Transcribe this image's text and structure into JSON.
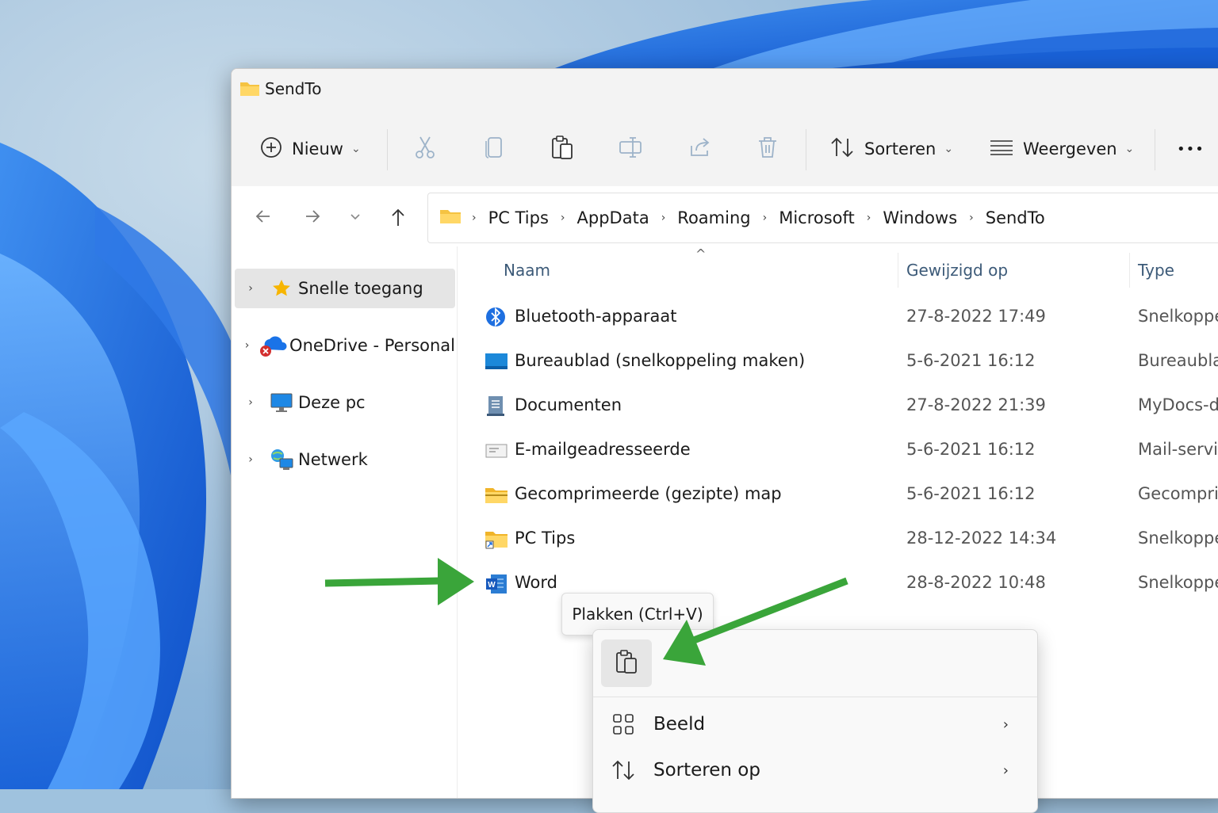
{
  "window": {
    "title": "SendTo"
  },
  "toolbar": {
    "new_label": "Nieuw",
    "sort_label": "Sorteren",
    "view_label": "Weergeven",
    "more_label": "•••",
    "buttons": [
      "cut-icon",
      "copy-icon",
      "paste-icon",
      "rename-icon",
      "share-icon",
      "delete-icon"
    ]
  },
  "breadcrumb": [
    "PC Tips",
    "AppData",
    "Roaming",
    "Microsoft",
    "Windows",
    "SendTo"
  ],
  "sidebar": {
    "items": [
      {
        "label": "Snelle toegang",
        "icon": "star-icon",
        "selected": true
      },
      {
        "label": "OneDrive - Personal",
        "icon": "onedrive-icon",
        "selected": false
      },
      {
        "label": "Deze pc",
        "icon": "computer-icon",
        "selected": false
      },
      {
        "label": "Netwerk",
        "icon": "network-icon",
        "selected": false
      }
    ]
  },
  "columns": {
    "name": "Naam",
    "modified": "Gewijzigd op",
    "type": "Type"
  },
  "files": [
    {
      "name": "Bluetooth-apparaat",
      "modified": "27-8-2022 17:49",
      "type": "Snelkoppeling",
      "icon": "bluetooth-icon"
    },
    {
      "name": "Bureaublad (snelkoppeling maken)",
      "modified": "5-6-2021 16:12",
      "type": "Bureaublad",
      "icon": "desktop-icon"
    },
    {
      "name": "Documenten",
      "modified": "27-8-2022 21:39",
      "type": "MyDocs-d",
      "icon": "documents-icon"
    },
    {
      "name": "E-mailgeadresseerde",
      "modified": "5-6-2021 16:12",
      "type": "Mail-service",
      "icon": "mail-icon"
    },
    {
      "name": "Gecomprimeerde (gezipte) map",
      "modified": "5-6-2021 16:12",
      "type": "Gecomprimeerd",
      "icon": "zip-folder-icon"
    },
    {
      "name": "PC Tips",
      "modified": "28-12-2022 14:34",
      "type": "Snelkoppeling",
      "icon": "folder-shortcut-icon"
    },
    {
      "name": "Word",
      "modified": "28-8-2022 10:48",
      "type": "Snelkoppeling",
      "icon": "word-icon"
    }
  ],
  "tooltip": {
    "text": "Plakken (Ctrl+V)"
  },
  "context_menu": {
    "items": [
      {
        "label": "Beeld",
        "icon": "grid-icon"
      },
      {
        "label": "Sorteren op",
        "icon": "sort-icon"
      }
    ]
  },
  "colors": {
    "accent_arrow": "#3aa53a",
    "selection": "#e5e5e5",
    "folder": "#f5c342"
  }
}
